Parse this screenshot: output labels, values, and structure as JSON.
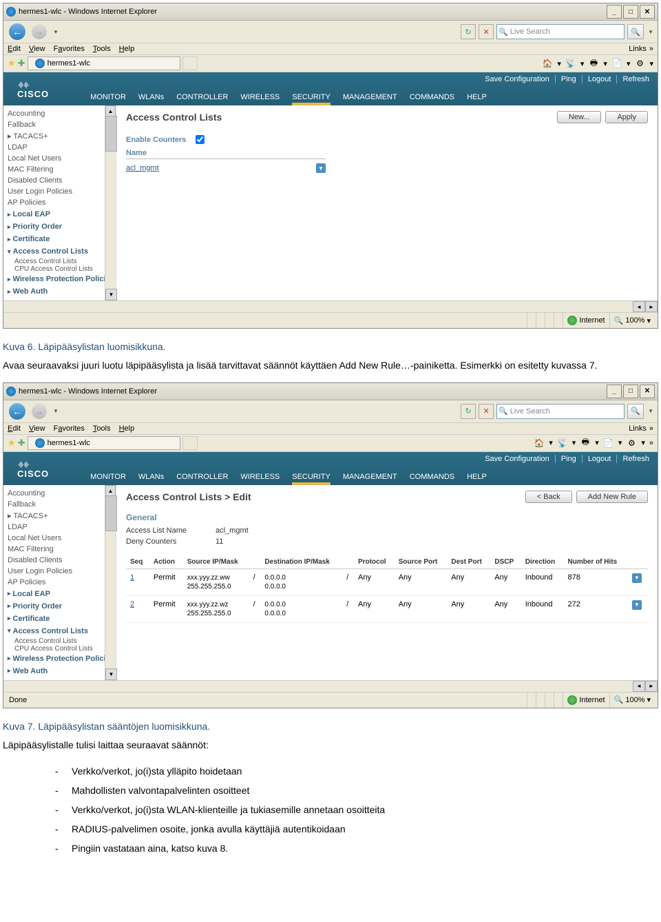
{
  "browser": {
    "title": "hermes1-wlc - Windows Internet Explorer",
    "search_placeholder": "Live Search",
    "menus": [
      "Edit",
      "View",
      "Favorites",
      "Tools",
      "Help"
    ],
    "links_label": "Links",
    "tab_title": "hermes1-wlc",
    "status_done": "Done",
    "status_zone": "Internet",
    "status_zoom": "100%"
  },
  "cisco": {
    "brand": "CISCO",
    "top_links": [
      "Save Configuration",
      "Ping",
      "Logout",
      "Refresh"
    ],
    "nav": [
      "MONITOR",
      "WLANs",
      "CONTROLLER",
      "WIRELESS",
      "SECURITY",
      "MANAGEMENT",
      "COMMANDS",
      "HELP"
    ],
    "active_nav": "SECURITY"
  },
  "sidebar": {
    "top_items": [
      "Accounting",
      "Fallback",
      "TACACS+",
      "LDAP",
      "Local Net Users",
      "MAC Filtering",
      "Disabled Clients",
      "User Login Policies",
      "AP Policies"
    ],
    "groups": [
      "Local EAP",
      "Priority Order",
      "Certificate",
      "Access Control Lists",
      "Wireless Protection Policies",
      "Web Auth"
    ],
    "acl_subs": [
      "Access Control Lists",
      "CPU Access Control Lists"
    ]
  },
  "screen1": {
    "title": "Access Control Lists",
    "btn_new": "New...",
    "btn_apply": "Apply",
    "enable_counters": "Enable Counters",
    "name_label": "Name",
    "acl_name": "acl_mgmt"
  },
  "screen2": {
    "title": "Access Control Lists > Edit",
    "btn_back": "< Back",
    "btn_add": "Add New Rule",
    "general": "General",
    "acl_name_label": "Access List Name",
    "acl_name_value": "acl_mgmt",
    "deny_label": "Deny Counters",
    "deny_value": "11",
    "cols": [
      "Seq",
      "Action",
      "Source IP/Mask",
      "Destination IP/Mask",
      "Protocol",
      "Source Port",
      "Dest Port",
      "DSCP",
      "Direction",
      "Number of Hits"
    ],
    "rows": [
      {
        "seq": "1",
        "action": "Permit",
        "src1": "xxx.yyy.zz.ww",
        "src2": "255.255.255.0",
        "dst1": "0.0.0.0",
        "dst2": "0.0.0.0",
        "proto": "Any",
        "sport": "Any",
        "dport": "Any",
        "dscp": "Any",
        "dir": "Inbound",
        "hits": "878"
      },
      {
        "seq": "2",
        "action": "Permit",
        "src1": "xxx.yyy.zz.wz",
        "src2": "255.255.255.0",
        "dst1": "0.0.0.0",
        "dst2": "0.0.0.0",
        "proto": "Any",
        "sport": "Any",
        "dport": "Any",
        "dscp": "Any",
        "dir": "Inbound",
        "hits": "272"
      }
    ]
  },
  "doc": {
    "caption1": "Kuva 6. Läpipääsylistan luomisikkuna.",
    "para1": "Avaa seuraavaksi juuri luotu läpipääsylista ja lisää tarvittavat säännöt käyttäen Add New Rule…-painiketta. Esimerkki on esitetty kuvassa 7.",
    "caption2": "Kuva 7. Läpipääsylistan sääntöjen luomisikkuna.",
    "para2": "Läpipääsylistalle tulisi laittaa seuraavat säännöt:",
    "bullets": [
      "Verkko/verkot, jo(i)sta ylläpito hoidetaan",
      "Mahdollisten valvontapalvelinten osoitteet",
      "Verkko/verkot, jo(i)sta WLAN-klienteille ja tukiasemille annetaan osoitteita",
      "RADIUS-palvelimen osoite, jonka avulla käyttäjiä autentikoidaan",
      "Pingiin vastataan aina, katso kuva 8."
    ]
  }
}
